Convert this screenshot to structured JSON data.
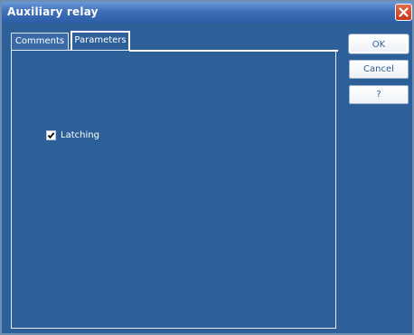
{
  "window": {
    "title": "Auxiliary relay"
  },
  "tabs": [
    {
      "label": "Comments"
    },
    {
      "label": "Parameters"
    }
  ],
  "parameters": {
    "latching_label": "Latching",
    "latching_checked": true
  },
  "buttons": {
    "ok": "OK",
    "cancel": "Cancel",
    "help": "?"
  },
  "colors": {
    "background": "#2d5f99",
    "title_bar": "#3d6eb8",
    "close_button": "#d2492a"
  },
  "icons": {
    "close": "close-icon",
    "check": "checkmark-icon"
  }
}
